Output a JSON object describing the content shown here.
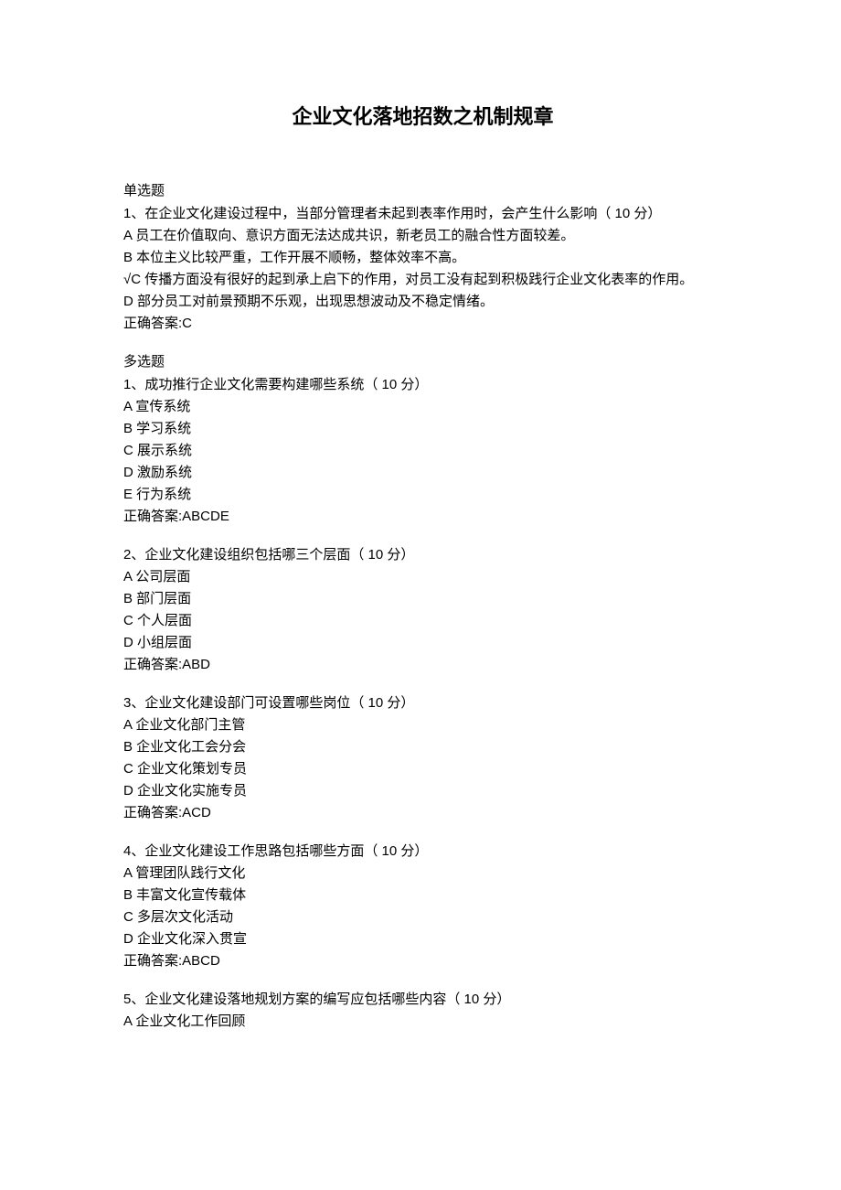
{
  "title": "企业文化落地招数之机制规章",
  "sections": {
    "single": {
      "heading": "单选题",
      "q1": {
        "stem": "1、在企业文化建设过程中，当部分管理者未起到表率作用时，会产生什么影响（ 10 分）",
        "optA": "A 员工在价值取向、意识方面无法达成共识，新老员工的融合性方面较差。",
        "optB": "B 本位主义比较严重，工作开展不顺畅，整体效率不高。",
        "optC": "√C 传播方面没有很好的起到承上启下的作用，对员工没有起到积极践行企业文化表率的作用。",
        "optD": "D 部分员工对前景预期不乐观，出现思想波动及不稳定情绪。",
        "answer": "正确答案:C"
      }
    },
    "multi": {
      "heading": "多选题",
      "q1": {
        "stem": "1、成功推行企业文化需要构建哪些系统（ 10 分）",
        "optA": "A 宣传系统",
        "optB": "B 学习系统",
        "optC": "C 展示系统",
        "optD": "D 激励系统",
        "optE": "E 行为系统",
        "answer": "正确答案:ABCDE"
      },
      "q2": {
        "stem": "2、企业文化建设组织包括哪三个层面（ 10 分）",
        "optA": "A 公司层面",
        "optB": "B 部门层面",
        "optC": "C 个人层面",
        "optD": "D 小组层面",
        "answer": "正确答案:ABD"
      },
      "q3": {
        "stem": "3、企业文化建设部门可设置哪些岗位（ 10 分）",
        "optA": "A 企业文化部门主管",
        "optB": "B 企业文化工会分会",
        "optC": "C 企业文化策划专员",
        "optD": "D 企业文化实施专员",
        "answer": "正确答案:ACD"
      },
      "q4": {
        "stem": "4、企业文化建设工作思路包括哪些方面（ 10 分）",
        "optA": "A 管理团队践行文化",
        "optB": "B 丰富文化宣传载体",
        "optC": "C 多层次文化活动",
        "optD": "D 企业文化深入贯宣",
        "answer": "正确答案:ABCD"
      },
      "q5": {
        "stem": "5、企业文化建设落地规划方案的编写应包括哪些内容（ 10 分）",
        "optA": "A 企业文化工作回顾"
      }
    }
  }
}
